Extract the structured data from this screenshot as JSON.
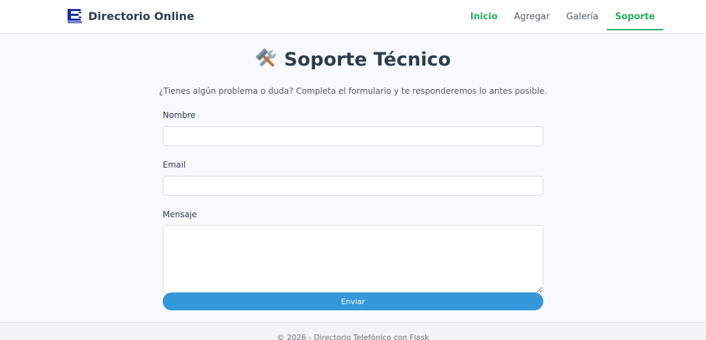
{
  "brand": {
    "title": "Directorio Online",
    "logo_icon": "contact-directory-logo",
    "logo_color": "#1a2aa8"
  },
  "nav": {
    "items": [
      {
        "label": "Inicio"
      },
      {
        "label": "Agregar"
      },
      {
        "label": "Galería"
      },
      {
        "label": "Soporte"
      }
    ],
    "active": "Soporte",
    "accent_color": "#27ae60"
  },
  "page": {
    "title": "Soporte Técnico",
    "title_icon": "hammer-and-wrench-icon",
    "subtitle": "¿Tienes algún problema o duda? Completa el formulario y te responderemos lo antes posible."
  },
  "form": {
    "name_label": "Nombre",
    "name_value": "",
    "email_label": "Email",
    "email_value": "",
    "message_label": "Mensaje",
    "message_value": "",
    "submit_label": "Enviar",
    "submit_color": "#3498db"
  },
  "footer": {
    "text": "© 2026 - Directorio Telefónico con Flask"
  }
}
